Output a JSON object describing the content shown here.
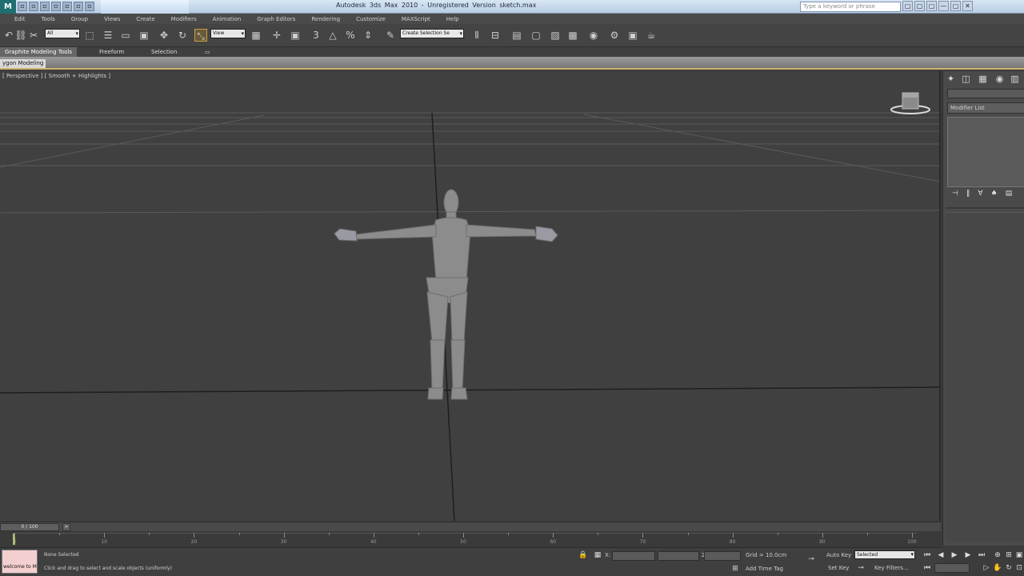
{
  "title_bar": {
    "app_logo": "M",
    "title": "Autodesk 3ds Max 2010 - Unregistered Version    sketch.max",
    "search_placeholder": "Type a keyword or phrase",
    "quick_access": [
      "▫",
      "▫",
      "▫",
      "▫",
      "▫",
      "▫",
      "▫"
    ],
    "window_buttons": [
      "▢",
      "▢",
      "▢",
      "—",
      "▢",
      "✕"
    ]
  },
  "menu": {
    "items": [
      "Edit",
      "Tools",
      "Group",
      "Views",
      "Create",
      "Modifiers",
      "Animation",
      "Graph Editors",
      "Rendering",
      "Customize",
      "MAXScript",
      "Help"
    ]
  },
  "toolbar": {
    "selection_filter": "All",
    "ref_coord": "View",
    "named_selection": "Create Selection Se"
  },
  "ribbon": {
    "tabs": [
      "Graphite Modeling Tools",
      "Freeform",
      "Selection"
    ],
    "active_tab": "Graphite Modeling Tools",
    "panel_label": "ygon Modeling"
  },
  "viewport": {
    "label": "[ Perspective ] [ Smooth + Highlights ]"
  },
  "command_panel": {
    "modifier_list": "Modifier List",
    "tabs": [
      "create",
      "modify",
      "hierarchy",
      "motion",
      "display",
      "utilities"
    ]
  },
  "time_slider": {
    "frame": "0 / 100",
    "ticks": [
      "0",
      "10",
      "20",
      "30",
      "40",
      "50",
      "60",
      "70",
      "80",
      "90",
      "100"
    ]
  },
  "status": {
    "maxscript_text": "welcome to M",
    "selection": "None Selected",
    "prompt": "Click and drag to select and scale objects (uniformly)",
    "grid": "Grid = 10.0cm",
    "add_time_tag": "Add Time Tag",
    "auto_key": "Auto Key",
    "set_key": "Set Key",
    "key_mode": "Selected",
    "key_filters": "Key Filters..."
  },
  "colors": {
    "viewport_bg": "#404040",
    "panel_bg": "#4a4a4a",
    "ribbon_accent": "#cdb469"
  }
}
